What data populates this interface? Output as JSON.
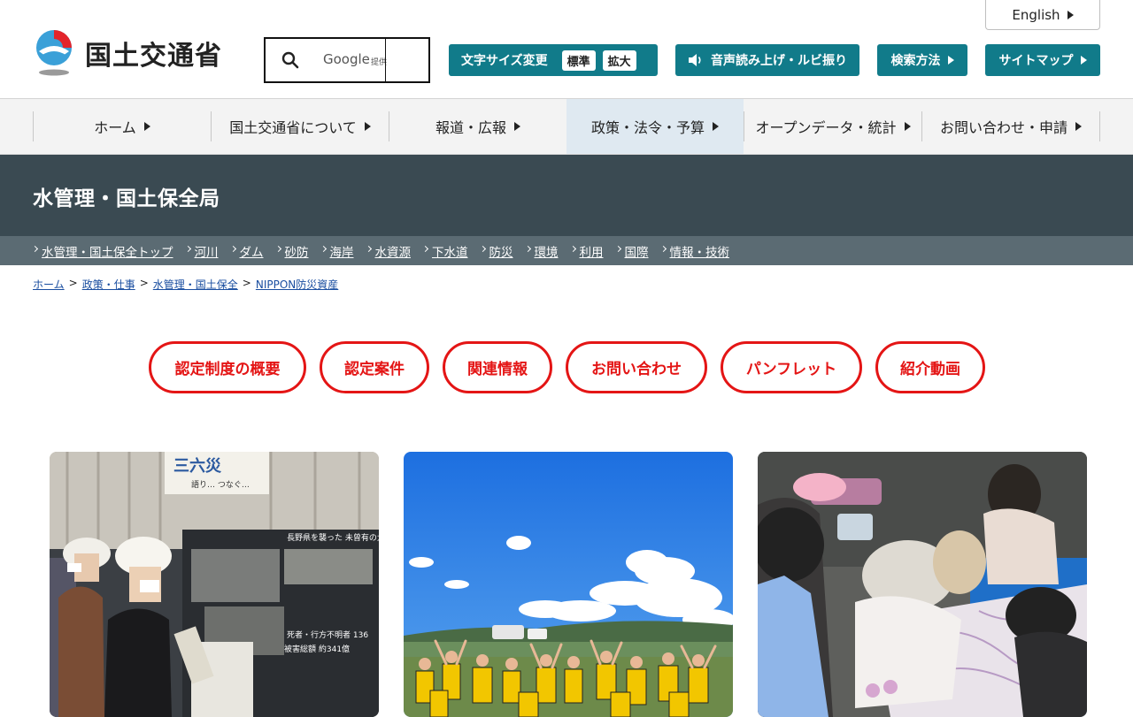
{
  "header": {
    "logo_text": "国土交通省",
    "search": {
      "provider": "Google",
      "provided_by": "提供"
    },
    "english_label": "English",
    "font_size": {
      "label": "文字サイズ変更",
      "normal": "標準",
      "large": "拡大"
    },
    "speech_label": "音声読み上げ・ルビ振り",
    "search_method_label": "検索方法",
    "sitemap_label": "サイトマップ"
  },
  "global_nav": [
    {
      "label": "ホーム"
    },
    {
      "label": "国土交通省について"
    },
    {
      "label": "報道・広報"
    },
    {
      "label": "政策・法令・予算",
      "active": true
    },
    {
      "label": "オープンデータ・統計"
    },
    {
      "label": "お問い合わせ・申請"
    }
  ],
  "section": {
    "title": "水管理・国土保全局",
    "links": [
      "水管理・国土保全トップ",
      "河川",
      "ダム",
      "砂防",
      "海岸",
      "水資源",
      "下水道",
      "防災",
      "環境",
      "利用",
      "国際",
      "情報・技術"
    ]
  },
  "breadcrumb": [
    "ホーム",
    "政策・仕事",
    "水管理・国土保全",
    "NIPPON防災資産"
  ],
  "breadcrumb_sep": ">",
  "page_buttons": [
    "認定制度の概要",
    "認定案件",
    "関連情報",
    "お問い合わせ",
    "パンフレット",
    "紹介動画"
  ],
  "photo_text": {
    "banner": "三六災",
    "banner_sub": "語り… つなぐ…",
    "panel_title": "長野県を襲った\n未曾有の大",
    "panel_line1": "死者・行方不明者 136",
    "panel_line2": "被害総額 約341億"
  },
  "colors": {
    "accent": "#117b8a",
    "section_bg": "#3a4a52",
    "subnav_bg": "#5b6b73",
    "pill_red": "#e41515",
    "link": "#1a4ea0"
  }
}
